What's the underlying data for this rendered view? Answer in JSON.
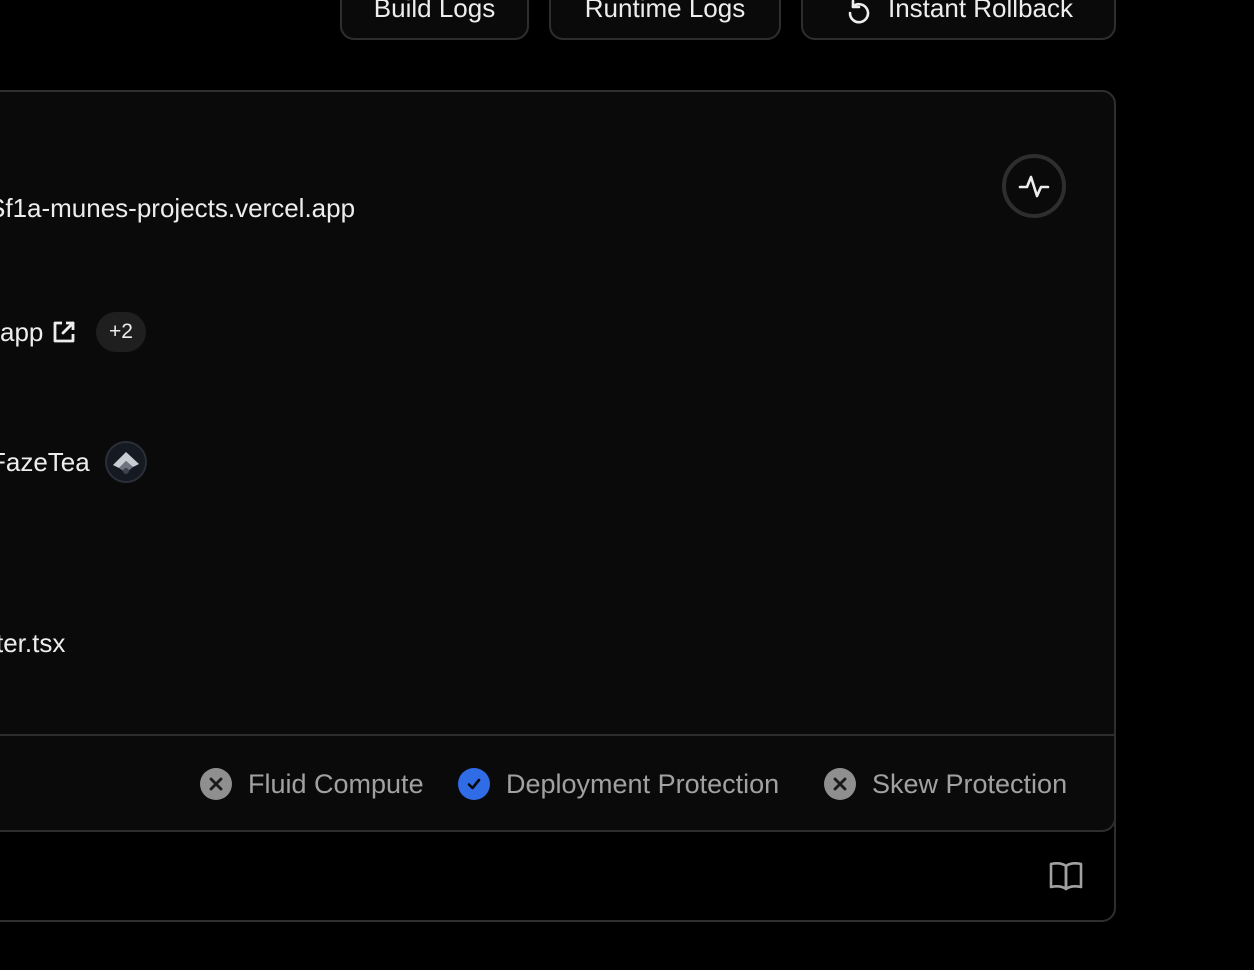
{
  "toolbar": {
    "build_logs_label": "Build Logs",
    "runtime_logs_label": "Runtime Logs",
    "instant_rollback_label": "Instant Rollback",
    "instant_rollback_icon": "rollback-icon"
  },
  "deployment": {
    "deployment_url": "Sf1a-munes-projects.vercel.app",
    "domain_text": "app",
    "domain_icon": "external-link-icon",
    "more_domains_count": "+2",
    "created_by": "FazeTea",
    "source_file": "ter.tsx",
    "activity_icon": "activity-icon"
  },
  "features": [
    {
      "label": "Fluid Compute",
      "enabled": false,
      "icon": "x-circle-icon"
    },
    {
      "label": "Deployment Protection",
      "enabled": true,
      "icon": "check-circle-icon"
    },
    {
      "label": "Skew Protection",
      "enabled": false,
      "icon": "x-circle-icon"
    }
  ],
  "colors": {
    "background": "#000000",
    "card": "#0a0a0a",
    "border": "#2e2e2e",
    "enabled_accent": "#2f6ce5",
    "disabled_status": "#8f8f8f",
    "text_primary": "#ededed",
    "text_secondary": "#a1a1a1"
  },
  "footer": {
    "docs_icon": "book-open-icon"
  }
}
